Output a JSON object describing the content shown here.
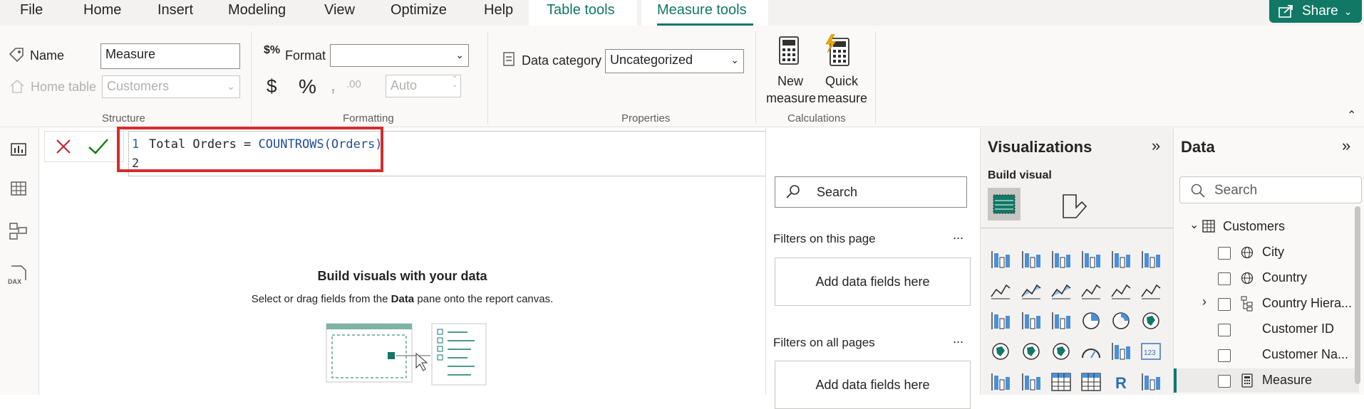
{
  "menu": {
    "tabs": [
      "File",
      "Home",
      "Insert",
      "Modeling",
      "View",
      "Optimize",
      "Help"
    ],
    "context_tabs": [
      "Table tools",
      "Measure tools"
    ],
    "active_tab": "Measure tools",
    "share_label": "Share"
  },
  "ribbon": {
    "name_label": "Name",
    "name_value": "Measure",
    "home_table_label": "Home table",
    "home_table_value": "Customers",
    "structure_title": "Structure",
    "format_label": "Format",
    "format_value": "",
    "currency_symbol": "$",
    "percent_symbol": "%",
    "comma_symbol": "‚",
    "decimal_symbol": ".00",
    "auto_value": "Auto",
    "formatting_title": "Formatting",
    "data_category_label": "Data category",
    "data_category_value": "Uncategorized",
    "properties_title": "Properties",
    "new_measure_line1": "New",
    "new_measure_line2": "measure",
    "quick_measure_line1": "Quick",
    "quick_measure_line2": "measure",
    "calculations_title": "Calculations"
  },
  "formula": {
    "line1_no": "1",
    "line1_lhs": "Total Orders = ",
    "line1_func": "COUNTROWS(Orders)",
    "line2_no": "2"
  },
  "canvas": {
    "heading": "Build visuals with your data",
    "sub_before": "Select or drag fields from the ",
    "sub_bold": "Data",
    "sub_after": " pane onto the report canvas."
  },
  "filters": {
    "search_placeholder": "Search",
    "page_title": "Filters on this page",
    "all_title": "Filters on all pages",
    "add_fields": "Add data fields here",
    "more": "..."
  },
  "visualizations": {
    "title": "Visualizations",
    "build_visual": "Build visual",
    "r_label": "R",
    "num_label": "123"
  },
  "data_pane": {
    "title": "Data",
    "search_placeholder": "Search",
    "table": "Customers",
    "fields": [
      "City",
      "Country",
      "Country Hiera...",
      "Customer ID",
      "Customer Na...",
      "Measure"
    ]
  },
  "colors": {
    "accent": "#117865",
    "highlight_border": "#d62b2b"
  }
}
